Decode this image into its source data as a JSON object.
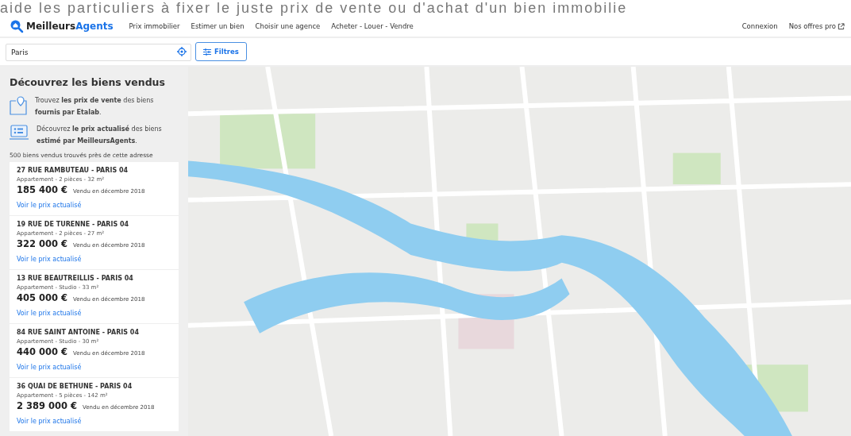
{
  "banner": {
    "text": "aide les particuliers à fixer le juste prix de vente ou d'achat d'un bien immobilie"
  },
  "header": {
    "logo": {
      "part1": "Meilleurs",
      "part2": "Agents"
    },
    "nav": [
      "Prix immobilier",
      "Estimer un bien",
      "Choisir une agence",
      "Acheter - Louer - Vendre"
    ],
    "right": [
      {
        "label": "Connexion",
        "external": false
      },
      {
        "label": "Nos offres pro",
        "external": true
      }
    ]
  },
  "search": {
    "value": "Paris",
    "filters_button": "Filtres"
  },
  "sidebar": {
    "title": "Découvrez les biens vendus",
    "features": [
      {
        "kind": "pin",
        "text": "Trouvez **les prix de vente** des biens **fournis par Etalab**."
      },
      {
        "kind": "screen",
        "text": "Découvrez **le prix actualisé** des biens **estimé par MeilleursAgents**."
      }
    ],
    "count": "500 biens vendus trouvés près de cette adresse",
    "listings": [
      {
        "address": "27 RUE RAMBUTEAU - PARIS 04",
        "details": "Appartement - 2 pièces - 32 m²",
        "price": "185 400 €",
        "sold": "Vendu en décembre 2018",
        "link": "Voir le prix actualisé"
      },
      {
        "address": "19 RUE DE TURENNE - PARIS 04",
        "details": "Appartement - 2 pièces - 27 m²",
        "price": "322 000 €",
        "sold": "Vendu en décembre 2018",
        "link": "Voir le prix actualisé"
      },
      {
        "address": "13 RUE BEAUTREILLIS - PARIS 04",
        "details": "Appartement - Studio - 33 m²",
        "price": "405 000 €",
        "sold": "Vendu en décembre 2018",
        "link": "Voir le prix actualisé"
      },
      {
        "address": "84 RUE SAINT ANTOINE - PARIS 04",
        "details": "Appartement - Studio - 30 m²",
        "price": "440 000 €",
        "sold": "Vendu en décembre 2018",
        "link": "Voir le prix actualisé"
      },
      {
        "address": "36 QUAI DE BETHUNE - PARIS 04",
        "details": "Appartement - 5 pièces - 142 m²",
        "price": "2 389 000 €",
        "sold": "Vendu en décembre 2018",
        "link": "Voir le prix actualisé"
      }
    ]
  }
}
